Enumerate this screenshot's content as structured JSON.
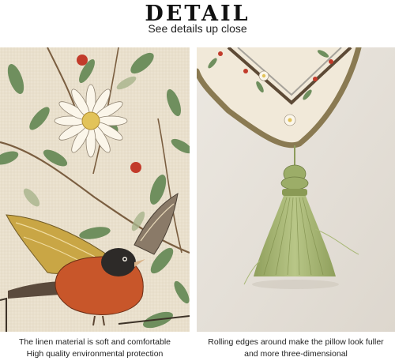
{
  "header": {
    "title": "DETAIL",
    "subtitle": "See details up close"
  },
  "panels": [
    {
      "subject": "embroidered-bird-and-daisy-linen",
      "caption_lines": [
        "The linen material is soft and comfortable",
        "High quality environmental protection"
      ]
    },
    {
      "subject": "pillow-corner-with-green-tassel",
      "caption_lines": [
        "Rolling edges around make the pillow look fuller",
        "and more three-dimensional"
      ]
    }
  ],
  "colors": {
    "linen": "#ece3d1",
    "leaf": "#6f8f5e",
    "bird_breast": "#c8562a",
    "wing_gold": "#c9a645",
    "berry": "#c23b2b",
    "tassel": "#a9b877",
    "piping": "#8a7a52",
    "wall": "#e6e1da"
  }
}
